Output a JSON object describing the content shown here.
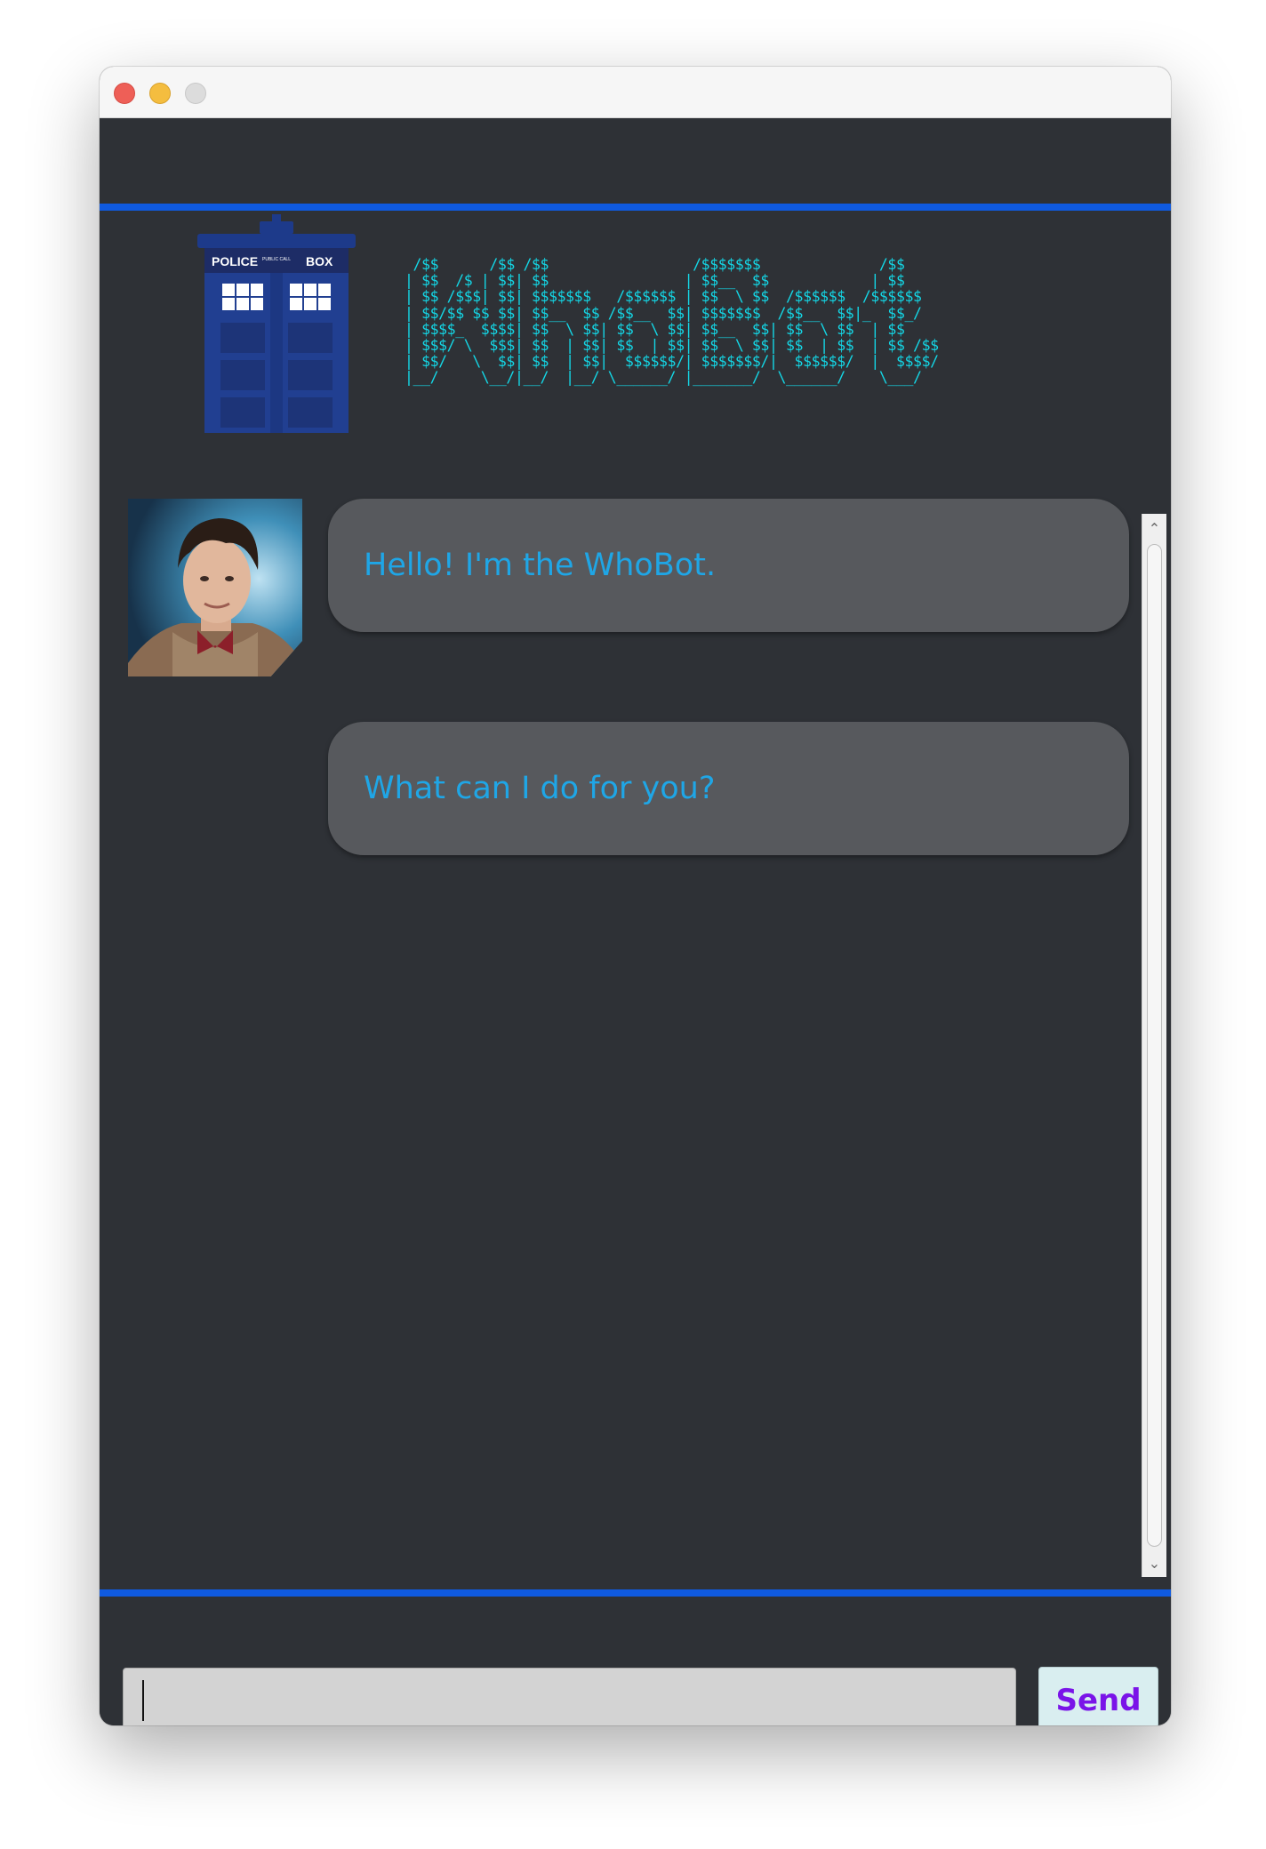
{
  "header": {
    "ascii_logo": " /$$      /$$ /$$                 /$$$$$$$              /$$    \n| $$  /$ | $$| $$                | $$__  $$            | $$    \n| $$ /$$$| $$| $$$$$$$   /$$$$$$ | $$  \\ $$  /$$$$$$  /$$$$$$  \n| $$/$$ $$ $$| $$__  $$ /$$__  $$| $$$$$$$  /$$__  $$|_  $$_/  \n| $$$$_  $$$$| $$  \\ $$| $$  \\ $$| $$__  $$| $$  \\ $$  | $$    \n| $$$/ \\  $$$| $$  | $$| $$  | $$| $$  \\ $$| $$  | $$  | $$ /$$\n| $$/   \\  $$| $$  | $$|  $$$$$$/| $$$$$$$/|  $$$$$$/  |  $$$$/\n|__/     \\__/|__/  |__/ \\______/ |_______/  \\______/    \\___/  ",
    "tardis_sign_left": "POLICE",
    "tardis_sign_small": "PUBLIC CALL",
    "tardis_sign_right": "BOX"
  },
  "chat": {
    "messages": [
      {
        "text": "Hello! I'm the WhoBot."
      },
      {
        "text": "What can I do for you?"
      }
    ]
  },
  "input": {
    "value": ""
  },
  "send": {
    "label": "Send"
  },
  "colors": {
    "accent_blue": "#0f5ae0",
    "message_text": "#1fa6e6",
    "ascii_text": "#14d7e6",
    "send_text": "#7a14e8",
    "background": "#2e3136"
  },
  "icons": {
    "avatar": "doctor-avatar-icon",
    "logo": "tardis-icon"
  }
}
